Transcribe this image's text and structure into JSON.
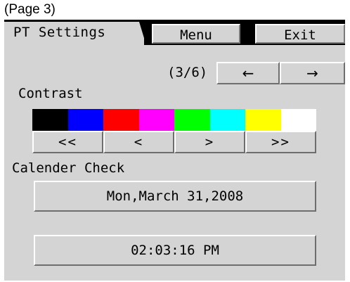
{
  "page_label": "(Page 3)",
  "header": {
    "tab_title": "PT Settings",
    "menu_label": "Menu",
    "exit_label": "Exit"
  },
  "pager": {
    "counter": "(3/6)",
    "prev_label": "←",
    "next_label": "→"
  },
  "contrast": {
    "label": "Contrast",
    "swatches": [
      "#000000",
      "#0000ff",
      "#ff0000",
      "#ff00ff",
      "#00ff00",
      "#00ffff",
      "#ffff00",
      "#ffffff"
    ],
    "buttons": [
      "<<",
      "<",
      ">",
      ">>"
    ]
  },
  "calendar": {
    "label": "Calender Check",
    "date": "Mon,March 31,2008",
    "time": "02:03:16 PM"
  },
  "colors": {
    "panel_bg": "#d4d4d4",
    "header_black": "#000000"
  }
}
